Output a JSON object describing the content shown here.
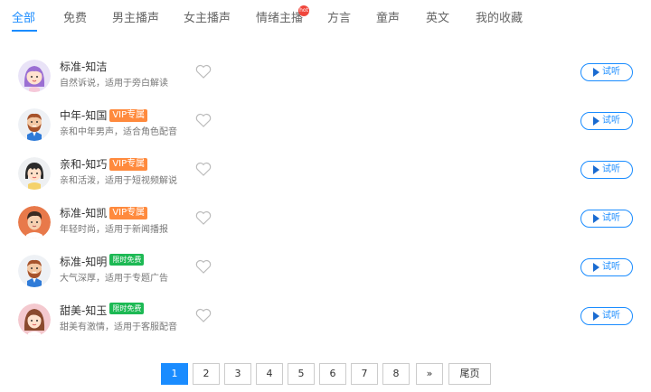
{
  "tabs": [
    {
      "label": "全部",
      "active": true
    },
    {
      "label": "免费"
    },
    {
      "label": "男主播声"
    },
    {
      "label": "女主播声"
    },
    {
      "label": "情绪主播",
      "hot": true
    },
    {
      "label": "方言"
    },
    {
      "label": "童声"
    },
    {
      "label": "英文"
    },
    {
      "label": "我的收藏"
    }
  ],
  "hot_badge_text": "hot",
  "voices": [
    {
      "name": "标准-知洁",
      "desc": "自然诉说，适用于旁白解读",
      "badge": "",
      "avatar_icon": "girl-purple-hair-icon"
    },
    {
      "name": "中年-知国",
      "desc": "亲和中年男声，适合角色配音",
      "badge": "VIP专属",
      "badge_type": "vip",
      "avatar_icon": "bearded-man-icon"
    },
    {
      "name": "亲和-知巧",
      "desc": "亲和活泼，适用于短视频解说",
      "badge": "VIP专属",
      "badge_type": "vip",
      "avatar_icon": "girl-bangs-icon"
    },
    {
      "name": "标准-知凯",
      "desc": "年轻时尚，适用于新闻播报",
      "badge": "VIP专属",
      "badge_type": "vip",
      "avatar_icon": "young-man-icon"
    },
    {
      "name": "标准-知明",
      "desc": "大气深厚，适用于专题广告",
      "badge": "限时免费",
      "badge_type": "free",
      "avatar_icon": "bearded-man-icon"
    },
    {
      "name": "甜美-知玉",
      "desc": "甜美有激情，适用于客服配音",
      "badge": "限时免费",
      "badge_type": "free",
      "avatar_icon": "woman-brown-hair-icon"
    }
  ],
  "listen_label": "试听",
  "pagination": {
    "pages": [
      "1",
      "2",
      "3",
      "4",
      "5",
      "6",
      "7",
      "8"
    ],
    "current": "1",
    "next_label": "»",
    "last_label": "尾页"
  },
  "colors": {
    "accent": "#1a8cff",
    "vip": "#ff8a3d",
    "free": "#1db954"
  }
}
